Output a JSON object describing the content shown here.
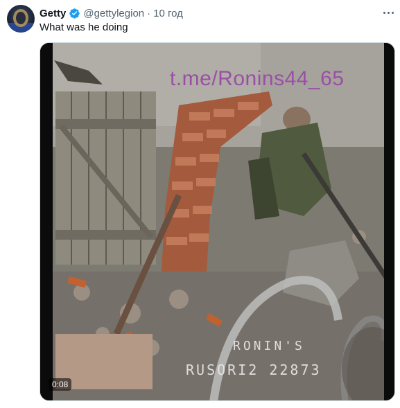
{
  "tweet": {
    "author_name": "Getty",
    "author_handle": "@gettylegion",
    "separator": "·",
    "timestamp": "10 год",
    "text": "What was he doing",
    "verified_color": "#1d9bf0"
  },
  "media": {
    "watermark": "t.me/Ronins44_65",
    "osd_line1": "RONIN'S",
    "osd_line2": "RUSORI2 22873",
    "duration": "0:08",
    "blur_color": "#b49a86"
  },
  "icons": {
    "verified": "verified-badge-icon",
    "more": "more-options-icon"
  }
}
